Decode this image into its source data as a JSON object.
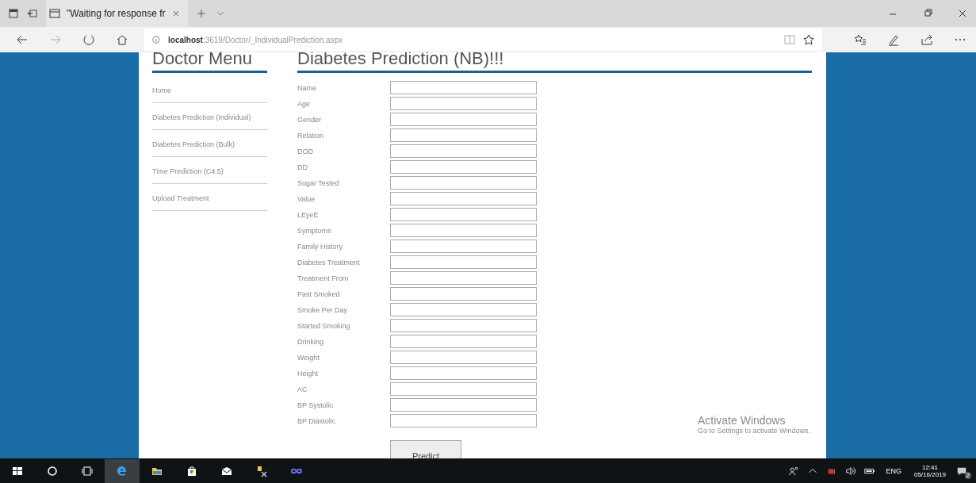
{
  "browser": {
    "tab_title": "\"Waiting for response fr",
    "url_host": "localhost",
    "url_path": ":3619/Doctor/_IndividualPrediction.aspx"
  },
  "sidebar": {
    "title": "Doctor Menu",
    "items": [
      {
        "label": "Home"
      },
      {
        "label": "Diabetes Prediction (Individual)"
      },
      {
        "label": "Diabetes Prediction (Bulk)"
      },
      {
        "label": "Time Prediction (C4.5)"
      },
      {
        "label": "Upload Treatment"
      }
    ]
  },
  "form": {
    "title": "Diabetes Prediction (NB)!!!",
    "fields": [
      {
        "label": "Name"
      },
      {
        "label": "Age"
      },
      {
        "label": "Gender"
      },
      {
        "label": "Relation"
      },
      {
        "label": "DOD"
      },
      {
        "label": "DD"
      },
      {
        "label": "Sugar Tested"
      },
      {
        "label": "Value"
      },
      {
        "label": "LEyeE"
      },
      {
        "label": "Symptoms"
      },
      {
        "label": "Family History"
      },
      {
        "label": "Diabetes Treatment"
      },
      {
        "label": "Treatment From"
      },
      {
        "label": "Past Smoked"
      },
      {
        "label": "Smoke Per Day"
      },
      {
        "label": "Started Smoking"
      },
      {
        "label": "Drinking"
      },
      {
        "label": "Weight"
      },
      {
        "label": "Height"
      },
      {
        "label": "AC"
      },
      {
        "label": "BP Systolic"
      },
      {
        "label": "BP Diastolic"
      }
    ],
    "button": "Predict"
  },
  "activation": {
    "title": "Activate Windows",
    "text": "Go to Settings to activate Windows."
  },
  "taskbar": {
    "language": "ENG",
    "time": "12:41",
    "date": "05/16/2019",
    "notifications": "2"
  }
}
